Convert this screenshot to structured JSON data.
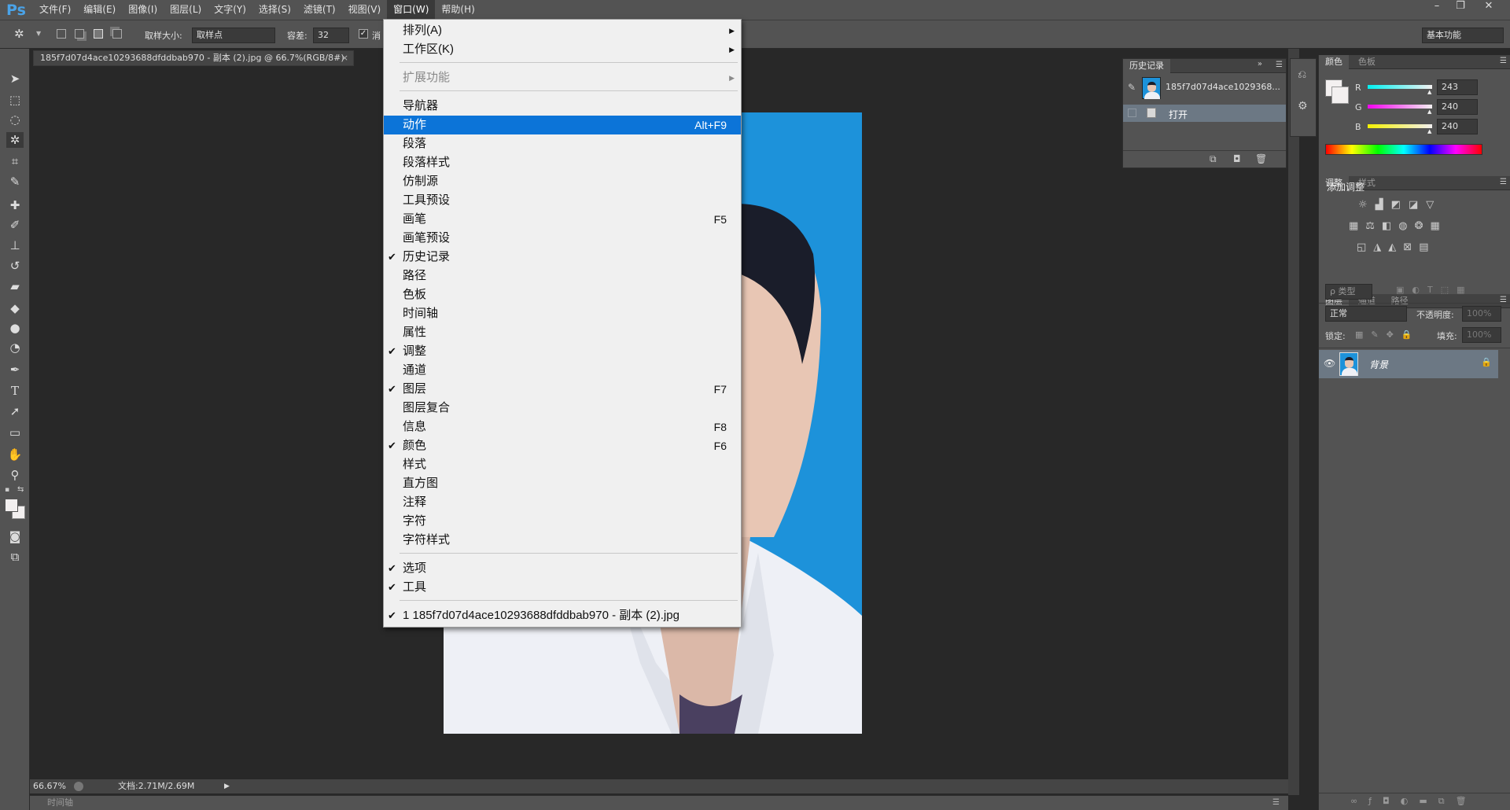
{
  "app": {
    "logo": "Ps"
  },
  "menubar": {
    "items": [
      "文件(F)",
      "编辑(E)",
      "图像(I)",
      "图层(L)",
      "文字(Y)",
      "选择(S)",
      "滤镜(T)",
      "视图(V)",
      "窗口(W)",
      "帮助(H)"
    ],
    "active_index": 8
  },
  "window_controls": {
    "minimize": "–",
    "restore": "❐",
    "close": "✕"
  },
  "options_bar": {
    "sample_size_label": "取样大小:",
    "sample_size_value": "取样点",
    "tolerance_label": "容差:",
    "tolerance_value": "32",
    "antialias_label": "消",
    "workspace": "基本功能"
  },
  "document": {
    "tab_title": "185f7d07d4ace10293688dfddbab970 - 副本 (2).jpg @ 66.7%(RGB/8#)",
    "close": "×"
  },
  "status_bar": {
    "zoom": "66.67%",
    "doc_info": "文档:2.71M/2.69M"
  },
  "timeline": {
    "label": "时间轴"
  },
  "history_panel": {
    "tab": "历史记录",
    "snapshot_name": "185f7d07d4ace1029368...",
    "entries": [
      "打开"
    ]
  },
  "color_panel": {
    "tabs": [
      "颜色",
      "色板"
    ],
    "r_label": "R",
    "r_value": "243",
    "g_label": "G",
    "g_value": "240",
    "b_label": "B",
    "b_value": "240",
    "foreground": "#f3f0f0"
  },
  "adjust_panel": {
    "tabs": [
      "调整",
      "样式"
    ],
    "title": "添加调整"
  },
  "layers_panel": {
    "tabs": [
      "图层",
      "通道",
      "路径"
    ],
    "filter": "ρ 类型",
    "blend_mode": "正常",
    "opacity_label": "不透明度:",
    "opacity_value": "100%",
    "lock_label": "锁定:",
    "fill_label": "填充:",
    "fill_value": "100%",
    "layer_name": "背景"
  },
  "window_menu": {
    "items": [
      {
        "label": "排列(A)",
        "submenu": true
      },
      {
        "label": "工作区(K)",
        "submenu": true
      },
      {
        "label": "扩展功能",
        "submenu": true,
        "disabled": true
      },
      {
        "label": "导航器"
      },
      {
        "label": "动作",
        "shortcut": "Alt+F9",
        "highlighted": true
      },
      {
        "label": "段落"
      },
      {
        "label": "段落样式"
      },
      {
        "label": "仿制源"
      },
      {
        "label": "工具预设"
      },
      {
        "label": "画笔",
        "shortcut": "F5"
      },
      {
        "label": "画笔预设"
      },
      {
        "label": "历史记录",
        "checked": true
      },
      {
        "label": "路径"
      },
      {
        "label": "色板"
      },
      {
        "label": "时间轴"
      },
      {
        "label": "属性"
      },
      {
        "label": "调整",
        "checked": true
      },
      {
        "label": "通道"
      },
      {
        "label": "图层",
        "checked": true,
        "shortcut": "F7"
      },
      {
        "label": "图层复合"
      },
      {
        "label": "信息",
        "shortcut": "F8"
      },
      {
        "label": "颜色",
        "checked": true,
        "shortcut": "F6"
      },
      {
        "label": "样式"
      },
      {
        "label": "直方图"
      },
      {
        "label": "注释"
      },
      {
        "label": "字符"
      },
      {
        "label": "字符样式"
      },
      {
        "label": "选项",
        "checked": true
      },
      {
        "label": "工具",
        "checked": true
      },
      {
        "label": "1 185f7d07d4ace10293688dfddbab970 - 副本 (2).jpg",
        "checked": true
      }
    ],
    "check_glyph": "✔",
    "arrow_glyph": "▶"
  }
}
